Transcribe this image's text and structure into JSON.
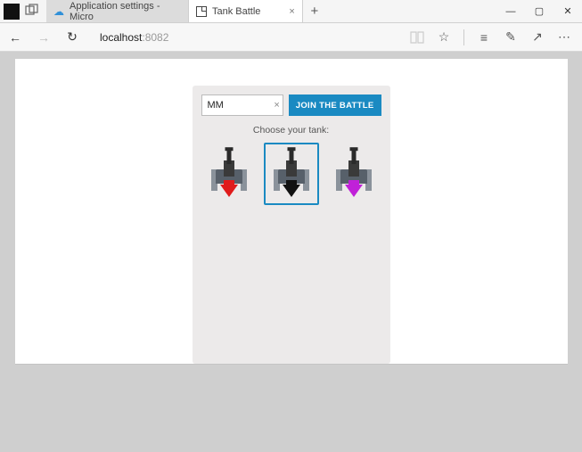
{
  "window": {
    "tabs": [
      {
        "title": "Application settings - Micro",
        "active": false
      },
      {
        "title": "Tank Battle",
        "active": true
      }
    ]
  },
  "address": {
    "host": "localhost",
    "port": ":8082"
  },
  "game": {
    "name_value": "MM",
    "clear_label": "×",
    "join_label": "JOIN THE BATTLE",
    "choose_label": "Choose your tank:",
    "tanks": [
      {
        "accent": "#e01b1b",
        "selected": false
      },
      {
        "accent": "#111111",
        "selected": true
      },
      {
        "accent": "#c021d8",
        "selected": false
      }
    ]
  },
  "colors": {
    "accent": "#1a8ac2"
  }
}
